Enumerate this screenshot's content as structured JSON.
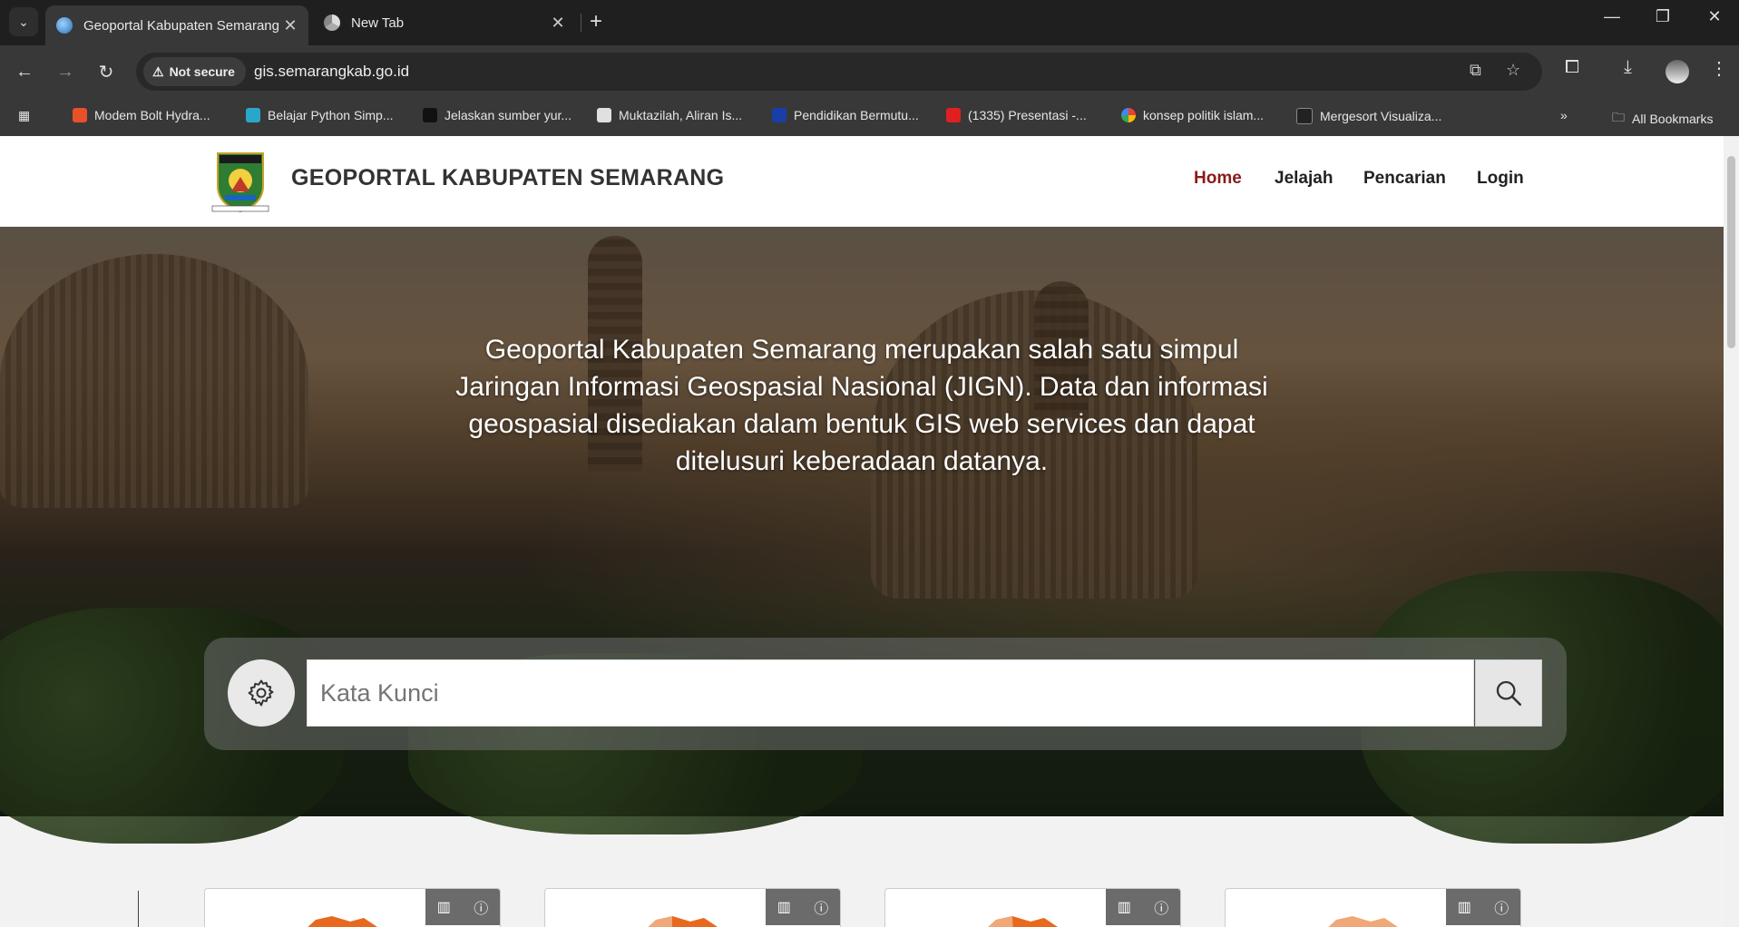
{
  "browser": {
    "tabs": [
      {
        "title": "Geoportal Kabupaten Semarang",
        "active": true
      },
      {
        "title": "New Tab",
        "active": false
      }
    ],
    "security_label": "Not secure",
    "url": "gis.semarangkab.go.id",
    "bookmarks": [
      {
        "label": "Modem Bolt Hydra...",
        "color": "#e8502a"
      },
      {
        "label": "Belajar Python Simp...",
        "color": "#2aa6c9"
      },
      {
        "label": "Jelaskan sumber yur...",
        "color": "#111111"
      },
      {
        "label": "Muktazilah, Aliran Is...",
        "color": "#e0e0e0"
      },
      {
        "label": "Pendidikan Bermutu...",
        "color": "#1a3ea8"
      },
      {
        "label": "(1335) Presentasi -...",
        "color": "#e02020"
      },
      {
        "label": "konsep politik islam...",
        "color": "#ffffff"
      },
      {
        "label": "Mergesort Visualiza...",
        "color": "#222222"
      }
    ],
    "all_bookmarks_label": "All Bookmarks"
  },
  "site": {
    "title": "GEOPORTAL KABUPATEN SEMARANG",
    "logo_text": "KABUPATEN SEMARANG",
    "logo_motto": "DHARMOTTAMA SATYA PRAJA",
    "nav": [
      {
        "label": "Home",
        "active": true
      },
      {
        "label": "Jelajah",
        "active": false
      },
      {
        "label": "Pencarian",
        "active": false
      },
      {
        "label": "Login",
        "active": false
      }
    ]
  },
  "hero": {
    "description": "Geoportal Kabupaten Semarang merupakan salah satu simpul Jaringan Informasi Geospasial Nasional (JIGN). Data dan informasi geospasial disediakan dalam bentuk GIS web services dan dapat ditelusuri keberadaan datanya.",
    "search_placeholder": "Kata Kunci",
    "search_value": ""
  },
  "cards": [
    {
      "map_color": "#e8681e",
      "icons": [
        "map-icon",
        "info-icon"
      ]
    },
    {
      "map_color": "#f0a878",
      "icons": [
        "map-icon",
        "info-icon"
      ]
    },
    {
      "map_color": "#e8681e",
      "icons": [
        "map-icon",
        "info-icon"
      ]
    },
    {
      "map_color": "#f0a878",
      "icons": [
        "map-icon",
        "info-icon"
      ]
    }
  ],
  "colors": {
    "nav_active": "#8b1a1a",
    "header_bg": "#ffffff",
    "chrome_bg": "#383838"
  }
}
